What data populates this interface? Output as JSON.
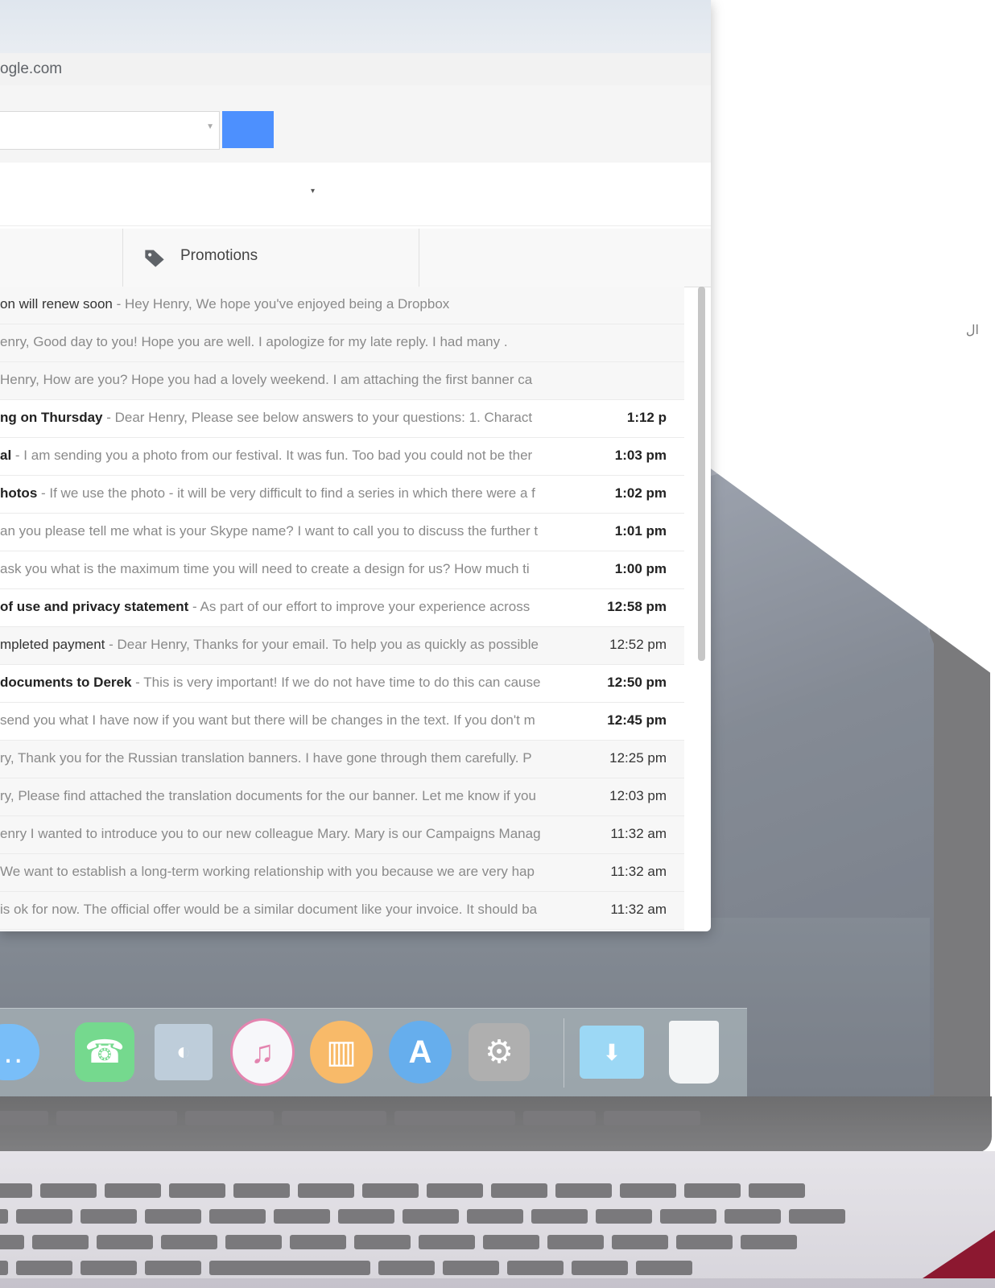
{
  "browser": {
    "address": "ogle.com"
  },
  "tabs": [
    {
      "label": "Promotions"
    }
  ],
  "emails": [
    {
      "subject": "on will renew soon",
      "snippet": " - Hey Henry, We hope you've enjoyed being a Dropbox",
      "time": "",
      "unread": false
    },
    {
      "subject": "",
      "snippet": "enry, Good day to you! Hope you are well. I apologize for my late reply. I had many .",
      "time": "",
      "unread": false
    },
    {
      "subject": "",
      "snippet": " Henry, How are you? Hope you had a lovely weekend. I am attaching the first banner ca",
      "time": "",
      "unread": false
    },
    {
      "subject": "ng on Thursday",
      "snippet": " - Dear Henry, Please see below answers to your questions: 1. Charact",
      "time": "1:12 p",
      "unread": true
    },
    {
      "subject": "al",
      "snippet": " - I am sending you a photo from our festival. It was fun. Too bad you could not be ther",
      "time": "1:03 pm",
      "unread": true
    },
    {
      "subject": "hotos",
      "snippet": " - If we use the photo - it will be very difficult to find a series in which there were a f",
      "time": "1:02 pm",
      "unread": true
    },
    {
      "subject": "",
      "snippet": "an you please tell me what is your Skype name? I want to call you to discuss the further t",
      "time": "1:01 pm",
      "unread": true
    },
    {
      "subject": "",
      "snippet": " ask you what is the maximum time you will need to create a design for us? How much ti",
      "time": "1:00 pm",
      "unread": true
    },
    {
      "subject": "of use and privacy statement",
      "snippet": " - As part of our effort to improve your experience across",
      "time": "12:58 pm",
      "unread": true
    },
    {
      "subject": "mpleted payment",
      "snippet": " - Dear Henry, Thanks for your email. To help you as quickly as possible",
      "time": "12:52 pm",
      "unread": false
    },
    {
      "subject": "documents to Derek",
      "snippet": " - This is very important! If we do not have time to do this can cause",
      "time": "12:50 pm",
      "unread": true
    },
    {
      "subject": "",
      "snippet": "send you what I have now if you want but there will be changes in the text. If you don't m",
      "time": "12:45 pm",
      "unread": true
    },
    {
      "subject": "",
      "snippet": "ry, Thank you for the Russian translation banners. I have gone through them carefully. P",
      "time": "12:25 pm",
      "unread": false
    },
    {
      "subject": "",
      "snippet": "ry, Please find attached the translation documents for the our banner. Let me know if you",
      "time": "12:03 pm",
      "unread": false
    },
    {
      "subject": "",
      "snippet": "enry I wanted to introduce you to our new colleague Mary. Mary is our Campaigns Manag",
      "time": "11:32 am",
      "unread": false
    },
    {
      "subject": "",
      "snippet": " We want to establish a long-term working relationship with you because we are very hap",
      "time": "11:32 am",
      "unread": false
    },
    {
      "subject": "",
      "snippet": "is ok for now. The official offer would be a similar document like your invoice. It should ba",
      "time": "11:32 am",
      "unread": false
    }
  ],
  "dock": {
    "apps": [
      {
        "icon": "messages-icon",
        "glyph": "💬",
        "color": "#3aa0f5"
      },
      {
        "icon": "facetime-icon",
        "glyph": "📞",
        "color": "#34c759"
      },
      {
        "icon": "preview-icon",
        "glyph": "🖼",
        "color": "#8aa7c2"
      },
      {
        "icon": "itunes-icon",
        "glyph": "♫",
        "color": "#e8e8ee"
      },
      {
        "icon": "ibooks-icon",
        "glyph": "📖",
        "color": "#f59a23"
      },
      {
        "icon": "app-store-icon",
        "glyph": "A",
        "color": "#1e88e5"
      },
      {
        "icon": "system-preferences-icon",
        "glyph": "⚙",
        "color": "#8a8a8a"
      },
      {
        "icon": "downloads-folder-icon",
        "glyph": "⬇",
        "color": "#6ec6f0"
      },
      {
        "icon": "trash-icon",
        "glyph": "🗑",
        "color": "#eef0f2"
      }
    ]
  },
  "corner_text": "ال",
  "colors": {
    "accent_blue": "#4d90fe",
    "red_corner": "#8c1830"
  }
}
